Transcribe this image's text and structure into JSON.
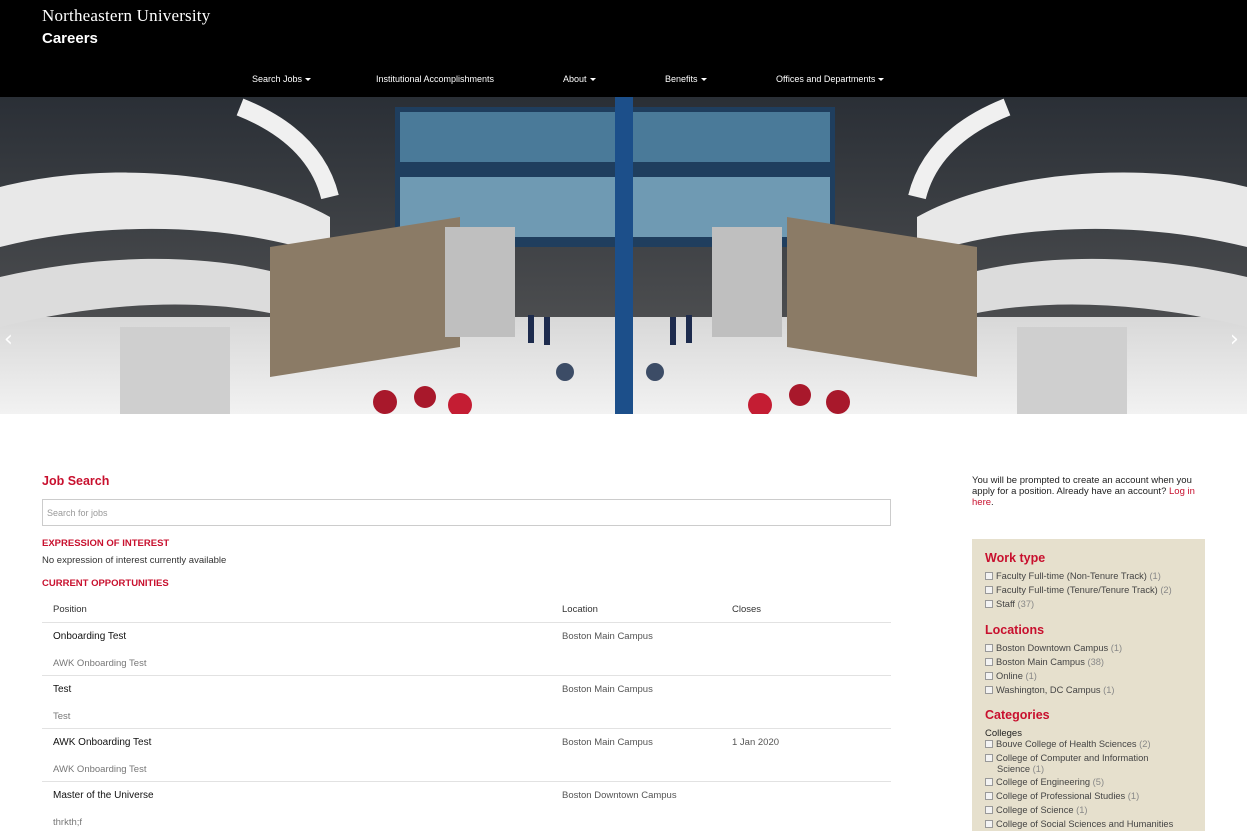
{
  "header": {
    "university": "Northeastern University",
    "careers": "Careers",
    "nav": [
      {
        "label": "Search Jobs",
        "dropdown": true
      },
      {
        "label": "Institutional Accomplishments",
        "dropdown": false
      },
      {
        "label": "About",
        "dropdown": true
      },
      {
        "label": "Benefits",
        "dropdown": true
      },
      {
        "label": "Offices and Departments",
        "dropdown": true
      }
    ]
  },
  "hero": {
    "prev": "‹",
    "next": "›"
  },
  "job_search": {
    "title": "Job Search",
    "search_placeholder": "Search for jobs",
    "eoi_title": "EXPRESSION OF INTEREST",
    "eoi_text": "No expression of interest currently available",
    "current_title": "CURRENT OPPORTUNITIES",
    "columns": {
      "position": "Position",
      "location": "Location",
      "closes": "Closes"
    },
    "jobs": [
      {
        "title": "Onboarding Test",
        "location": "Boston Main Campus",
        "closes": "",
        "desc": "AWK Onboarding Test"
      },
      {
        "title": "Test",
        "location": "Boston Main Campus",
        "closes": "",
        "desc": "Test"
      },
      {
        "title": "AWK Onboarding Test",
        "location": "Boston Main Campus",
        "closes": "1 Jan 2020",
        "desc": "AWK Onboarding Test"
      },
      {
        "title": "Master of the Universe",
        "location": "Boston Downtown Campus",
        "closes": "",
        "desc": "thrkth;f"
      }
    ]
  },
  "sidebar": {
    "account_note": "You will be prompted to create an account when you apply for a position. Already have an account?",
    "login_link": "Log in here",
    "login_suffix": ".",
    "work_type": {
      "title": "Work type",
      "items": [
        {
          "label": "Faculty Full-time (Non-Tenure Track)",
          "count": "(1)"
        },
        {
          "label": "Faculty Full-time (Tenure/Tenure Track)",
          "count": "(2)"
        },
        {
          "label": "Staff",
          "count": "(37)"
        }
      ]
    },
    "locations": {
      "title": "Locations",
      "items": [
        {
          "label": "Boston Downtown Campus",
          "count": "(1)"
        },
        {
          "label": "Boston Main Campus",
          "count": "(38)"
        },
        {
          "label": "Online",
          "count": "(1)"
        },
        {
          "label": "Washington, DC Campus",
          "count": "(1)"
        }
      ]
    },
    "categories": {
      "title": "Categories",
      "subtitle": "Colleges",
      "items": [
        {
          "label": "Bouve College of Health Sciences",
          "count": "(2)"
        },
        {
          "label": "College of Computer and Information",
          "label2": "Science",
          "count": "(1)"
        },
        {
          "label": "College of Engineering",
          "count": "(5)"
        },
        {
          "label": "College of Professional Studies",
          "count": "(1)"
        },
        {
          "label": "College of Science",
          "count": "(1)"
        },
        {
          "label": "College of Social Sciences and Humanities",
          "count": ""
        }
      ]
    }
  }
}
